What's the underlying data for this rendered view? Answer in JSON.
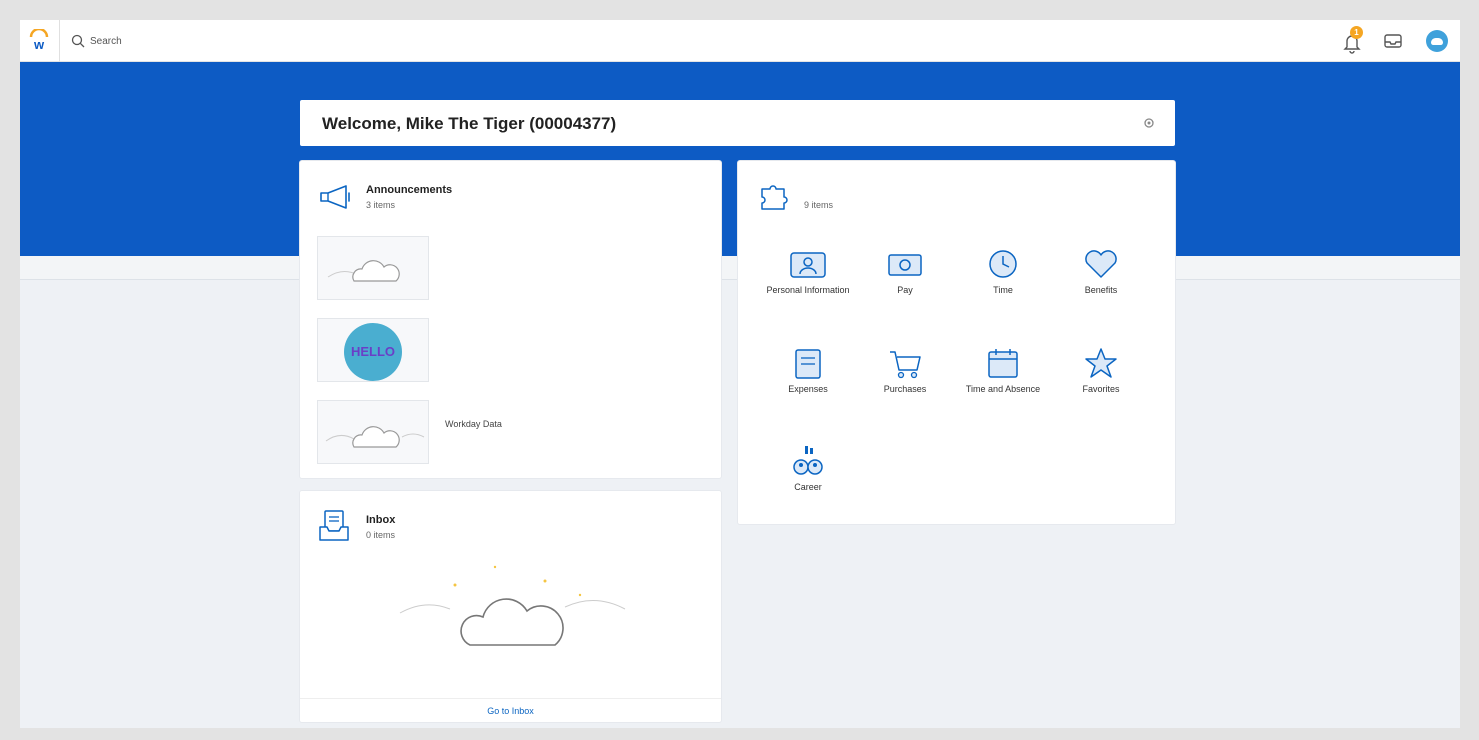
{
  "header": {
    "search_placeholder": "Search",
    "notification_count": "1"
  },
  "welcome": {
    "title": "Welcome, Mike The Tiger (00004377)"
  },
  "announcements": {
    "title": "Announcements",
    "count": "3 items",
    "items": [
      {
        "text": ""
      },
      {
        "text": ""
      },
      {
        "text": "Workday Data"
      }
    ]
  },
  "inbox": {
    "title": "Inbox",
    "count": "0 items",
    "link": "Go to Inbox"
  },
  "apps": {
    "count": "9 items",
    "items": [
      {
        "label": "Personal Information",
        "icon": "person-icon"
      },
      {
        "label": "Pay",
        "icon": "pay-icon"
      },
      {
        "label": "Time",
        "icon": "clock-icon"
      },
      {
        "label": "Benefits",
        "icon": "benefits-icon"
      },
      {
        "label": "Expenses",
        "icon": "expenses-icon"
      },
      {
        "label": "Purchases",
        "icon": "cart-icon"
      },
      {
        "label": "Time and Absence",
        "icon": "calendar-icon"
      },
      {
        "label": "Favorites",
        "icon": "star-icon"
      },
      {
        "label": "Career",
        "icon": "career-icon"
      }
    ]
  },
  "colors": {
    "brand_blue": "#0d5bc4",
    "accent_orange": "#f5a623",
    "link_blue": "#0b65c2"
  }
}
